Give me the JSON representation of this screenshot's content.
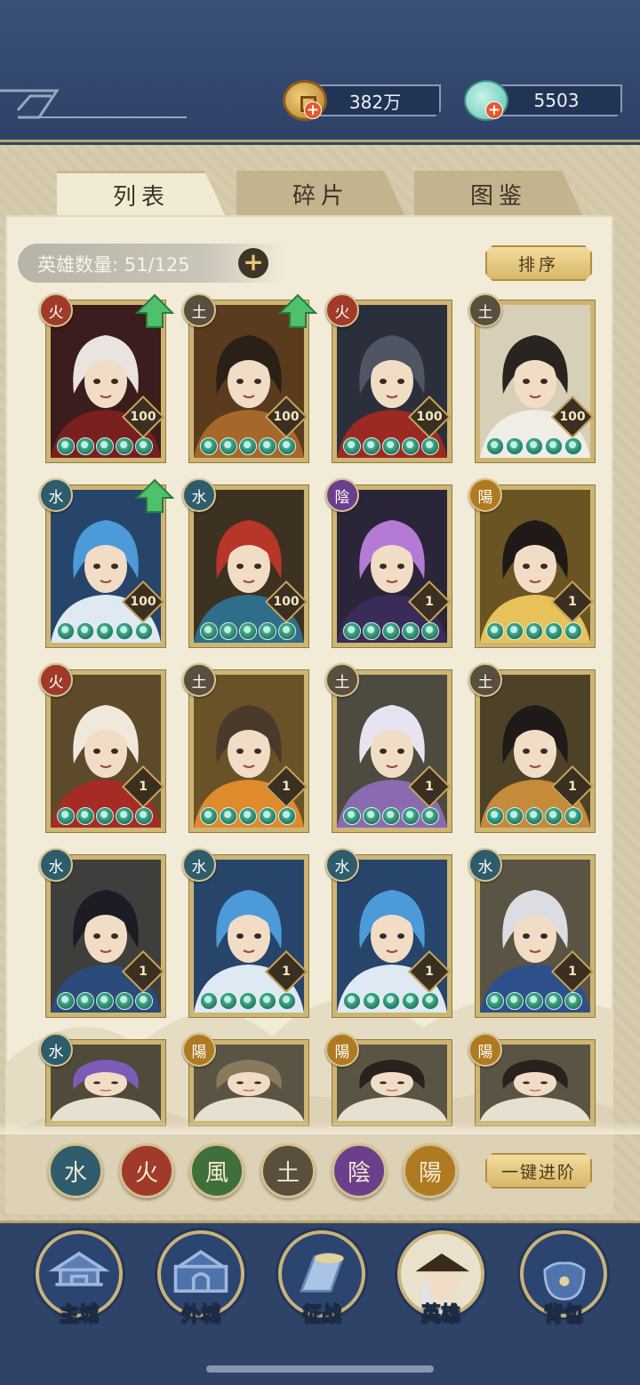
{
  "resources": {
    "coins": "382万",
    "jade": "5503"
  },
  "tabs": [
    {
      "label": "列表",
      "active": true
    },
    {
      "label": "碎片",
      "active": false
    },
    {
      "label": "图鉴",
      "active": false
    }
  ],
  "hero_count_label": "英雄数量: 51/125",
  "sort_label": "排序",
  "one_click_label": "一键进阶",
  "heroes": [
    {
      "element": "火",
      "elem_class": "fire",
      "level": "100",
      "upgrade": true,
      "stars": 5,
      "palette": "dark-red"
    },
    {
      "element": "土",
      "elem_class": "earth",
      "level": "100",
      "upgrade": true,
      "stars": 5,
      "palette": "gold"
    },
    {
      "element": "火",
      "elem_class": "fire",
      "level": "100",
      "upgrade": false,
      "stars": 5,
      "palette": "grey-red"
    },
    {
      "element": "土",
      "elem_class": "earth",
      "level": "100",
      "upgrade": false,
      "stars": 5,
      "palette": "cream"
    },
    {
      "element": "水",
      "elem_class": "water",
      "level": "100",
      "upgrade": true,
      "stars": 5,
      "palette": "blue"
    },
    {
      "element": "水",
      "elem_class": "water",
      "level": "100",
      "upgrade": false,
      "stars": 5,
      "palette": "red-hair"
    },
    {
      "element": "陰",
      "elem_class": "yin",
      "level": "1",
      "upgrade": false,
      "stars": 5,
      "palette": "purple"
    },
    {
      "element": "陽",
      "elem_class": "yang",
      "level": "1",
      "upgrade": false,
      "stars": 5,
      "palette": "yellow"
    },
    {
      "element": "火",
      "elem_class": "fire",
      "level": "1",
      "upgrade": false,
      "stars": 5,
      "palette": "crimson"
    },
    {
      "element": "土",
      "elem_class": "earth",
      "level": "1",
      "upgrade": false,
      "stars": 5,
      "palette": "orange"
    },
    {
      "element": "土",
      "elem_class": "earth",
      "level": "1",
      "upgrade": false,
      "stars": 5,
      "palette": "white-hair"
    },
    {
      "element": "土",
      "elem_class": "earth",
      "level": "1",
      "upgrade": false,
      "stars": 5,
      "palette": "green-gold"
    },
    {
      "element": "水",
      "elem_class": "water",
      "level": "1",
      "upgrade": false,
      "stars": 5,
      "palette": "dark-blue"
    },
    {
      "element": "水",
      "elem_class": "water",
      "level": "1",
      "upgrade": false,
      "stars": 5,
      "palette": "blue"
    },
    {
      "element": "水",
      "elem_class": "water",
      "level": "1",
      "upgrade": false,
      "stars": 5,
      "palette": "blue"
    },
    {
      "element": "水",
      "elem_class": "water",
      "level": "1",
      "upgrade": false,
      "stars": 5,
      "palette": "silver"
    },
    {
      "element": "水",
      "elem_class": "water",
      "level": "",
      "upgrade": false,
      "stars": 0,
      "palette": "violet"
    },
    {
      "element": "陽",
      "elem_class": "yang",
      "level": "",
      "upgrade": false,
      "stars": 0,
      "palette": "khaki"
    },
    {
      "element": "陽",
      "elem_class": "yang",
      "level": "",
      "upgrade": false,
      "stars": 0,
      "palette": "black-hair"
    },
    {
      "element": "陽",
      "elem_class": "yang",
      "level": "",
      "upgrade": false,
      "stars": 0,
      "palette": "black-hair"
    }
  ],
  "filters": [
    {
      "glyph": "水",
      "elem_class": "water"
    },
    {
      "glyph": "火",
      "elem_class": "fire"
    },
    {
      "glyph": "風",
      "elem_class": "wood"
    },
    {
      "glyph": "土",
      "elem_class": "earth"
    },
    {
      "glyph": "陰",
      "elem_class": "yin"
    },
    {
      "glyph": "陽",
      "elem_class": "yang"
    }
  ],
  "nav": [
    {
      "label": "主城",
      "icon": "palace-icon"
    },
    {
      "label": "外城",
      "icon": "city-gate-icon"
    },
    {
      "label": "征战",
      "icon": "war-horn-icon"
    },
    {
      "label": "英雄",
      "icon": "hero-portrait-icon",
      "active": true
    },
    {
      "label": "背包",
      "icon": "bag-icon"
    }
  ],
  "colors": {
    "navy": "#2f4368",
    "parchment": "#f2ebd8",
    "gold": "#c9b37a",
    "jade_star": "#42a88c",
    "upgrade_arrow": "#4fc06b"
  }
}
